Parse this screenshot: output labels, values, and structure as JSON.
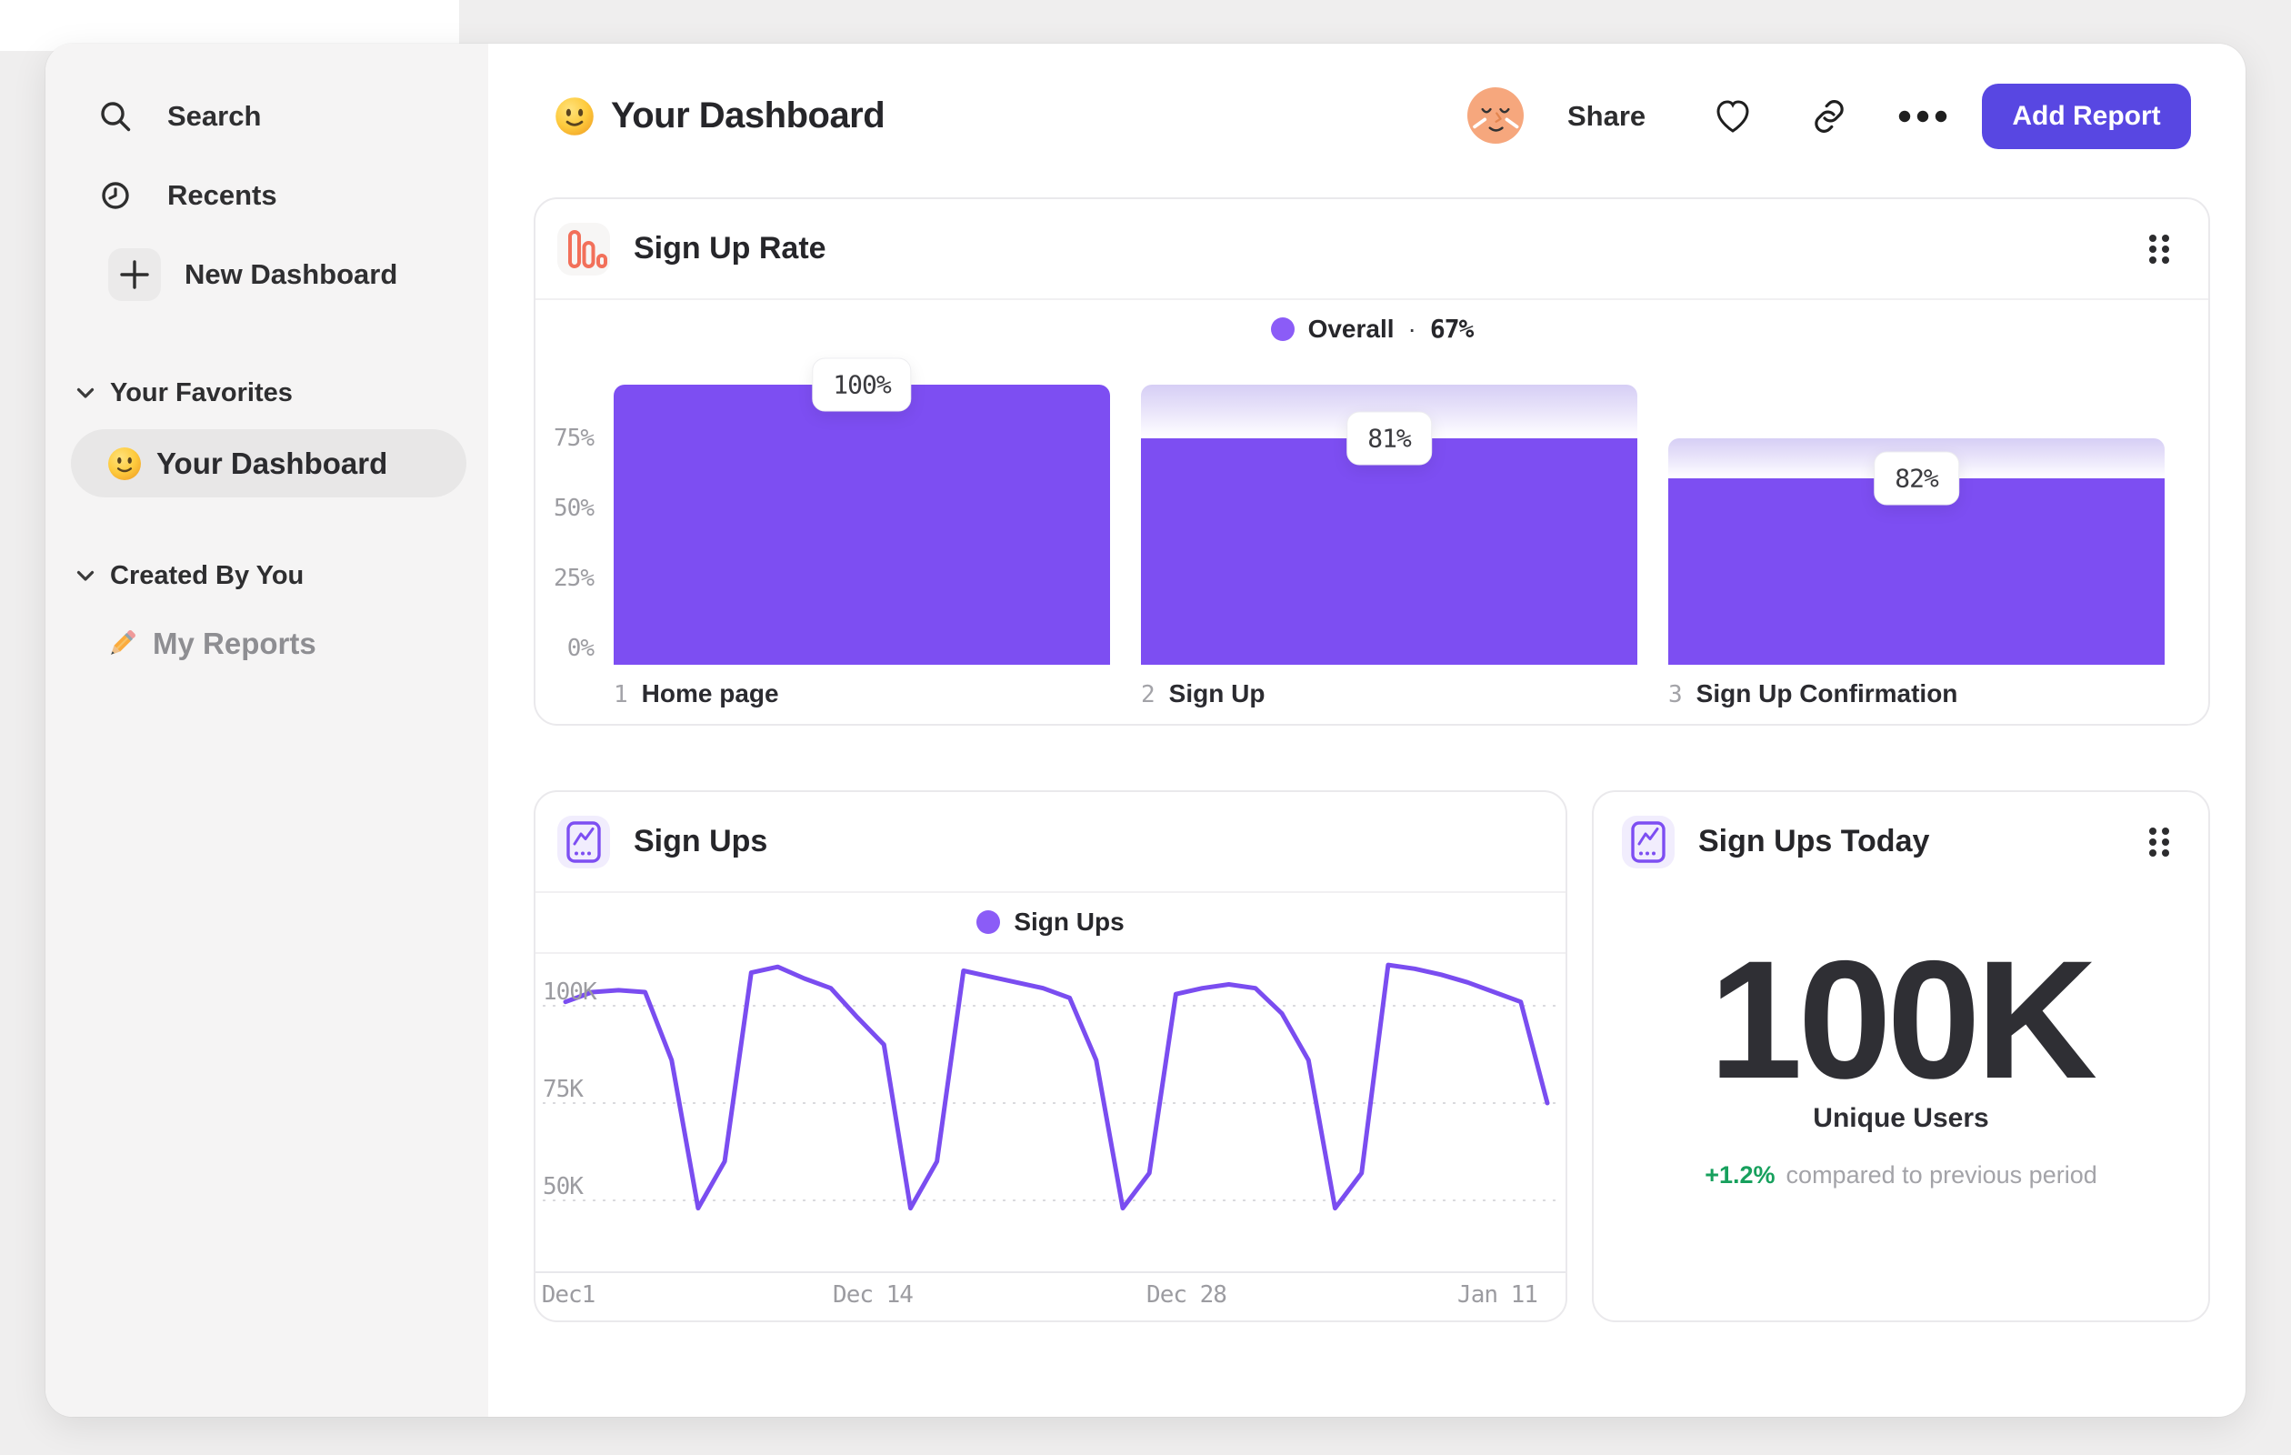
{
  "sidebar": {
    "nav_items": [
      {
        "label": "Search",
        "icon": "search-icon"
      },
      {
        "label": "Recents",
        "icon": "clock-icon"
      },
      {
        "label": "New Dashboard",
        "icon": "plus-icon"
      }
    ],
    "sections": [
      {
        "label": "Your Favorites",
        "items": [
          {
            "label": "Your Dashboard",
            "icon": "smiley-emoji",
            "selected": true
          }
        ]
      },
      {
        "label": "Created By You",
        "items": [
          {
            "label": "My Reports",
            "icon": "pencil-emoji",
            "selected": false
          }
        ]
      }
    ]
  },
  "header": {
    "title": "Your Dashboard",
    "title_emoji": "slightly-smiling-face",
    "share_label": "Share",
    "add_report_label": "Add Report"
  },
  "colors": {
    "accent_purple": "#7d4ef2",
    "legend_dot": "#8b5cf7",
    "line_purple": "#7a4df0",
    "button_indigo": "#5847e2",
    "funnel_icon_orange": "#f2705a",
    "delta_green": "#17a05d"
  },
  "chart_data": [
    {
      "type": "bar",
      "subtype": "funnel",
      "title": "Sign Up Rate",
      "legend": [
        {
          "name": "Overall",
          "value_label": "67%",
          "value_pct": 67
        }
      ],
      "legend_separator": "·",
      "categories": [
        "Home page",
        "Sign Up",
        "Sign Up Confirmation"
      ],
      "step_numbers": [
        "1",
        "2",
        "3"
      ],
      "step_conversion_labels": [
        "100%",
        "81%",
        "82%"
      ],
      "solid_pct": [
        100,
        81,
        66.4
      ],
      "ghost_top_pct": [
        100,
        100,
        81
      ],
      "yticks_pct": [
        75,
        50,
        25,
        0
      ],
      "ylim": [
        0,
        100
      ],
      "bar_color": "#7d4ef2",
      "grid": "off",
      "legend_position": "top-center"
    },
    {
      "type": "line",
      "title": "Sign Ups",
      "series": [
        {
          "name": "Sign Ups",
          "values_k": [
            101,
            103.5,
            104,
            103.5,
            86,
            48,
            60,
            108.5,
            110,
            107,
            104.5,
            97,
            90,
            48,
            60,
            109,
            107.5,
            106,
            104.5,
            102,
            86,
            48,
            57,
            103,
            104.5,
            105.5,
            104.5,
            98,
            86,
            48,
            57,
            110.5,
            109.5,
            108,
            106,
            103.5,
            101,
            75
          ]
        }
      ],
      "x_ticks": [
        "Dec1",
        "Dec 14",
        "Dec 28",
        "Jan 11"
      ],
      "y_ticks_k": [
        100,
        75,
        50
      ],
      "y_tick_labels": [
        "100K",
        "75K",
        "50K"
      ],
      "ylim_k": [
        32,
        114
      ],
      "line_color": "#7a4df0",
      "grid": "dashed-horizontal",
      "legend_position": "top-center"
    },
    {
      "type": "stat",
      "title": "Sign Ups Today",
      "value": "100K",
      "label": "Unique Users",
      "delta_label": "+1.2%",
      "delta_note": "compared to previous period",
      "delta_pct": 1.2
    }
  ]
}
